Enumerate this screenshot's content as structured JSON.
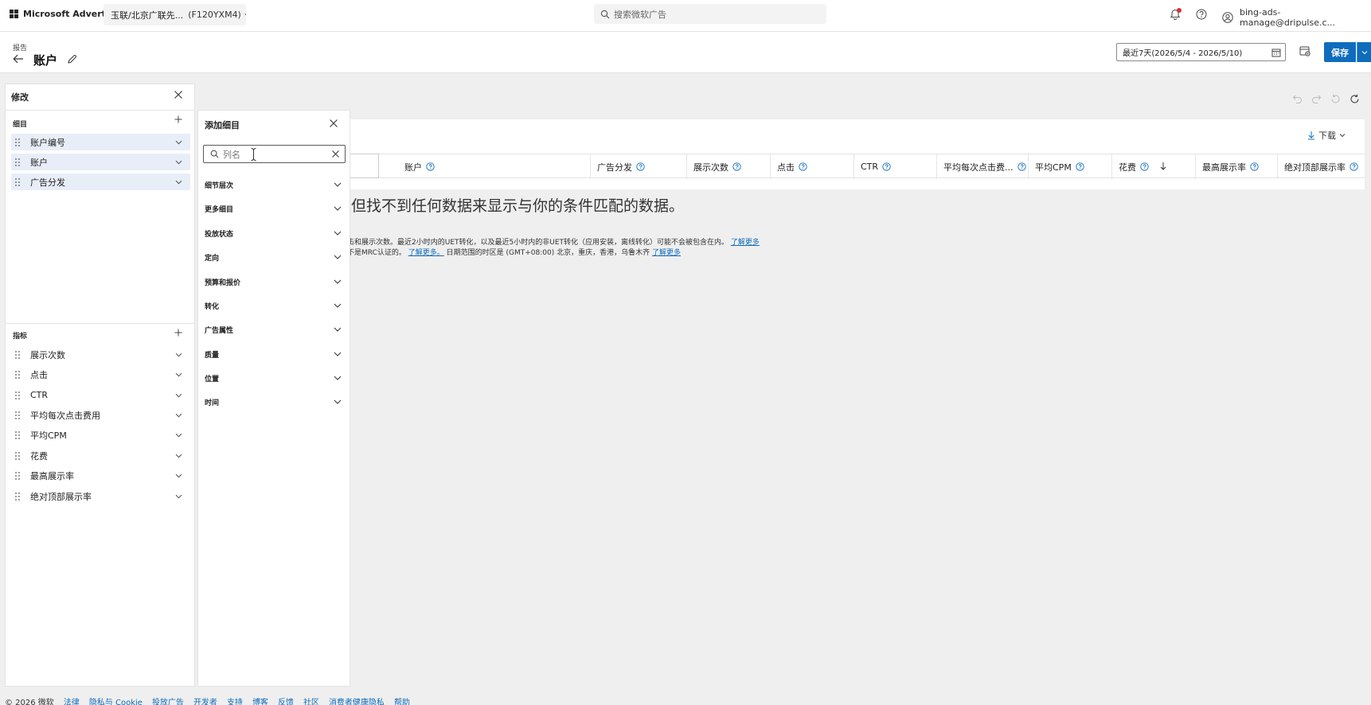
{
  "topbar": {
    "brand": "Microsoft Advertising",
    "account_name": "玉联/北京广联先...",
    "account_id": "(F120YXM4)",
    "search_placeholder": "搜索微软广告",
    "user_email": "bing-ads-manage@dripulse.c..."
  },
  "page": {
    "breadcrumb": "报告",
    "title": "账户",
    "date_range": "最近7天(2026/5/4 - 2026/5/10)",
    "save_label": "保存"
  },
  "table": {
    "download_label": "下载",
    "columns": [
      "账户",
      "广告分发",
      "展示次数",
      "点击",
      "CTR",
      "平均每次点击费...",
      "平均CPM",
      "花费",
      "最高展示率",
      "绝对顶部展示率"
    ],
    "empty_message": "但找不到任何数据来显示与你的条件匹配的数据。",
    "note1": "击和展示次数。最近2小时内的UET转化，以及最近5小时内的非UET转化（应用安装，离线转化）可能不会被包含在内。",
    "note1_link": "了解更多",
    "note2_prefix": "不是MRC认证的。",
    "note2_link": "了解更多。",
    "note2_mid": "日期范围的时区是 (GMT+08:00) 北京，重庆，香港，乌鲁木齐",
    "note2_link2": "了解更多"
  },
  "modify_panel": {
    "title": "修改",
    "dimensions_title": "细目",
    "dimensions": [
      "账户编号",
      "账户",
      "广告分发"
    ],
    "metrics_title": "指标",
    "metrics": [
      "展示次数",
      "点击",
      "CTR",
      "平均每次点击费用",
      "平均CPM",
      "花费",
      "最高展示率",
      "绝对顶部展示率"
    ]
  },
  "add_panel": {
    "title": "添加细目",
    "search_placeholder": "列名",
    "categories": [
      "细节层次",
      "更多细目",
      "投放状态",
      "定向",
      "预算和报价",
      "转化",
      "广告属性",
      "质量",
      "位置",
      "时间"
    ]
  },
  "footer": {
    "copyright": "© 2026 微软",
    "links": [
      "法律",
      "隐私与 Cookie",
      "投放广告",
      "开发者",
      "支持",
      "博客",
      "反馈",
      "社区",
      "消费者健康隐私",
      "帮助"
    ]
  },
  "colors": {
    "accent": "#0f6cbd",
    "background": "#efefef",
    "selected_item": "#e8eef8",
    "notification": "#d13438"
  }
}
